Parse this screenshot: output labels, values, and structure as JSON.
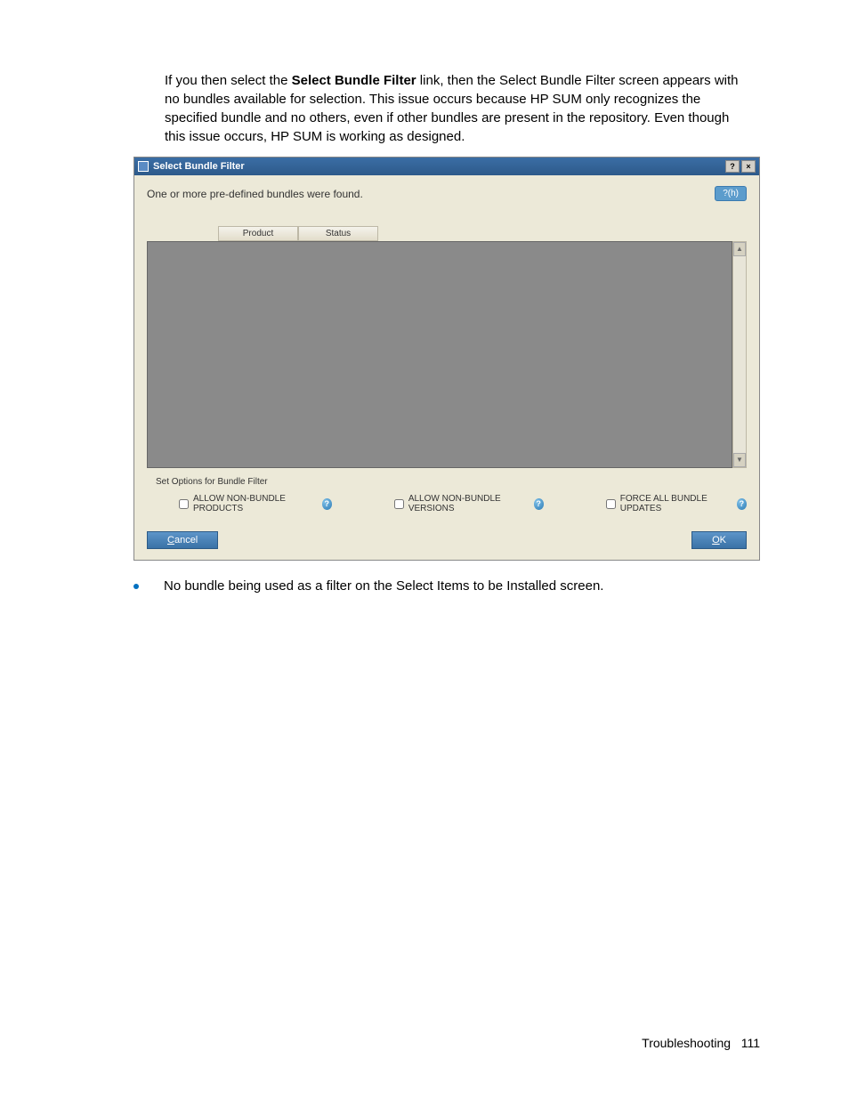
{
  "para": {
    "pre": "If you then select the ",
    "bold": "Select Bundle Filter",
    "post": " link, then the Select Bundle Filter screen appears with no bundles available for selection. This issue occurs because HP SUM only recognizes the specified bundle and no others, even if other bundles are present in the repository. Even though this issue occurs, HP SUM is working as designed."
  },
  "dialog": {
    "title": "Select Bundle Filter",
    "help_btn": "?",
    "close_btn": "×",
    "message": "One or more pre-defined bundles were found.",
    "badge": "?(h)",
    "columns": {
      "product": "Product",
      "status": "Status"
    },
    "scroll_up": "▲",
    "scroll_down": "▼",
    "options_label": "Set Options for Bundle Filter",
    "opt1": "ALLOW NON-BUNDLE PRODUCTS",
    "opt2": "ALLOW NON-BUNDLE VERSIONS",
    "opt3": "FORCE ALL BUNDLE UPDATES",
    "help_q": "?",
    "cancel_u": "C",
    "cancel_rest": "ancel",
    "ok_u": "O",
    "ok_rest": "K"
  },
  "bullet": "No bundle being used as a filter on the Select Items to be Installed screen.",
  "footer": {
    "section": "Troubleshooting",
    "page": "111"
  }
}
